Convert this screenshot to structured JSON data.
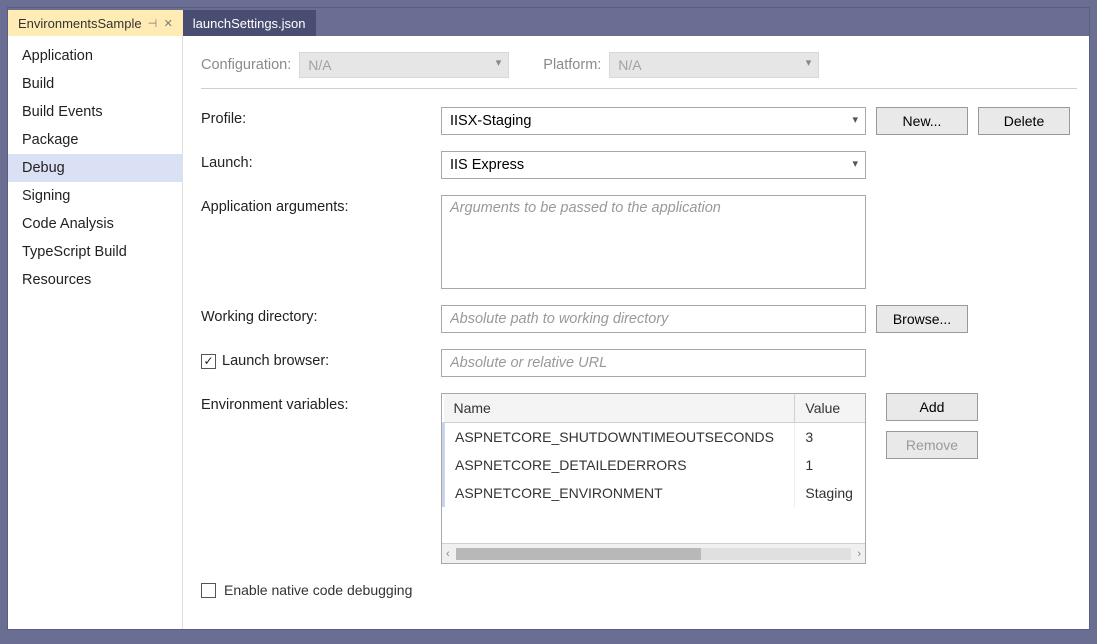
{
  "tabs": [
    {
      "label": "EnvironmentsSample",
      "active": true,
      "pinned": true,
      "closable": true
    },
    {
      "label": "launchSettings.json",
      "active": false,
      "pinned": false,
      "closable": false
    }
  ],
  "sidebar": {
    "items": [
      "Application",
      "Build",
      "Build Events",
      "Package",
      "Debug",
      "Signing",
      "Code Analysis",
      "TypeScript Build",
      "Resources"
    ],
    "selected": "Debug"
  },
  "topBar": {
    "configuration_label": "Configuration:",
    "configuration_value": "N/A",
    "platform_label": "Platform:",
    "platform_value": "N/A"
  },
  "form": {
    "profile_label": "Profile:",
    "profile_value": "IISX-Staging",
    "new_button": "New...",
    "delete_button": "Delete",
    "launch_label": "Launch:",
    "launch_value": "IIS Express",
    "app_args_label": "Application arguments:",
    "app_args_placeholder": "Arguments to be passed to the application",
    "working_dir_label": "Working directory:",
    "working_dir_placeholder": "Absolute path to working directory",
    "browse_button": "Browse...",
    "launch_browser_label": "Launch browser:",
    "launch_browser_checked": true,
    "launch_browser_placeholder": "Absolute or relative URL",
    "env_vars_label": "Environment variables:",
    "env_table": {
      "name_header": "Name",
      "value_header": "Value",
      "rows": [
        {
          "name": "ASPNETCORE_SHUTDOWNTIMEOUTSECONDS",
          "value": "3"
        },
        {
          "name": "ASPNETCORE_DETAILEDERRORS",
          "value": "1"
        },
        {
          "name": "ASPNETCORE_ENVIRONMENT",
          "value": "Staging"
        }
      ]
    },
    "add_button": "Add",
    "remove_button": "Remove",
    "native_debug_label": "Enable native code debugging",
    "native_debug_checked": false
  }
}
